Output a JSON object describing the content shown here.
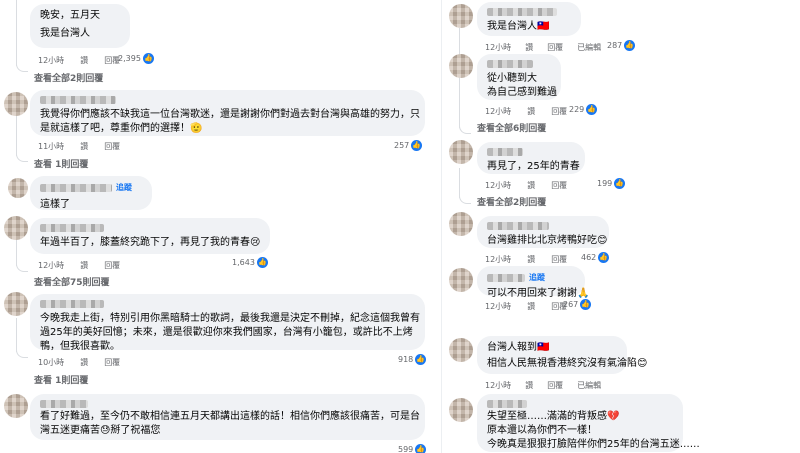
{
  "left": {
    "c1": {
      "lines": [
        "晚安，五月天",
        "我是台灣人"
      ],
      "time": "12小時",
      "reply": "讚",
      "reply2": "回覆",
      "likes": "2,395",
      "more": "查看全部2則回覆"
    },
    "c2": {
      "lines": [
        "我覺得你們應該不缺我這一位台灣歌迷，還是謝謝你們對過去對台灣與高雄的努力，只",
        "是就這樣了吧，尊重你們的選擇！🫡"
      ],
      "time": "11小時",
      "reply": "讚",
      "reply2": "回覆",
      "likes": "257",
      "more": "查看 1則回覆"
    },
    "c3": {
      "follow": "追蹤",
      "lines": [
        "這樣了"
      ],
      "time": "12小時",
      "reply": "讚",
      "reply2": "回覆"
    },
    "c4": {
      "lines": [
        "年過半百了，膝蓋終究跪下了，再見了我的青春😢"
      ],
      "time": "12小時",
      "reply": "讚",
      "reply2": "回覆",
      "likes": "1,643",
      "more": "查看全部75則回覆"
    },
    "c5": {
      "lines": [
        "今晚我走上街，特別引用你黑暗騎士的歌詞，最後我還是決定不刪掉，紀念這個我曾有",
        "過25年的美好回憶；未來，還是很歡迎你來我們國家，台灣有小籠包，或許比不上烤",
        "鴨，但我很喜歡。"
      ],
      "time": "10小時",
      "reply": "讚",
      "reply2": "回覆",
      "likes": "918",
      "more": "查看 1則回覆"
    },
    "c6": {
      "lines": [
        "看了好難過，至今仍不敢相信連五月天都講出這樣的話！相信你們應該很痛苦，可是台",
        "灣五迷更痛苦😓掰了祝福您"
      ],
      "likes": "599"
    }
  },
  "right": {
    "c1": {
      "lines": [
        "我是台灣人🇹🇼"
      ],
      "time": "12小時",
      "reply": "讚",
      "reply2": "回覆",
      "edited": "已編輯",
      "likes": "287"
    },
    "c2": {
      "lines": [
        "從小聽到大",
        "為自己感到難過"
      ],
      "time": "12小時",
      "reply": "讚",
      "reply2": "回覆",
      "likes": "229",
      "more": "查看全部6則回覆"
    },
    "c3": {
      "lines": [
        "再見了，25年的青春"
      ],
      "time": "12小時",
      "reply": "讚",
      "reply2": "回覆",
      "likes": "199",
      "more": "查看全部2則回覆"
    },
    "c4": {
      "lines": [
        "台灣雞排比北京烤鴨好吃😊"
      ],
      "time": "12小時",
      "reply": "讚",
      "reply2": "回覆",
      "likes": "462"
    },
    "c5": {
      "follow": "追蹤",
      "lines": [
        "可以不用回來了謝謝🙏"
      ],
      "time": "12小時",
      "reply": "讚",
      "reply2": "回覆",
      "likes": "267"
    },
    "c6": {
      "lines": [
        "台灣人報到🇹🇼",
        "相信人民無視香港終究沒有氣淪陷😊"
      ],
      "time": "12小時",
      "reply": "讚",
      "reply2": "回覆",
      "edited": "已編輯"
    },
    "c7": {
      "lines": [
        "失望至極……滿滿的背叛感💔",
        "原本還以為你們不一樣！",
        "今晚真是狠狠打臉陪伴你們25年的台灣五迷……"
      ]
    }
  },
  "colors": {
    "bubble": "#f0f2f5",
    "meta": "#65676b",
    "accent": "#1877f2"
  },
  "icons": {
    "like": "thumbs-up-icon",
    "more": "more-options-icon"
  }
}
